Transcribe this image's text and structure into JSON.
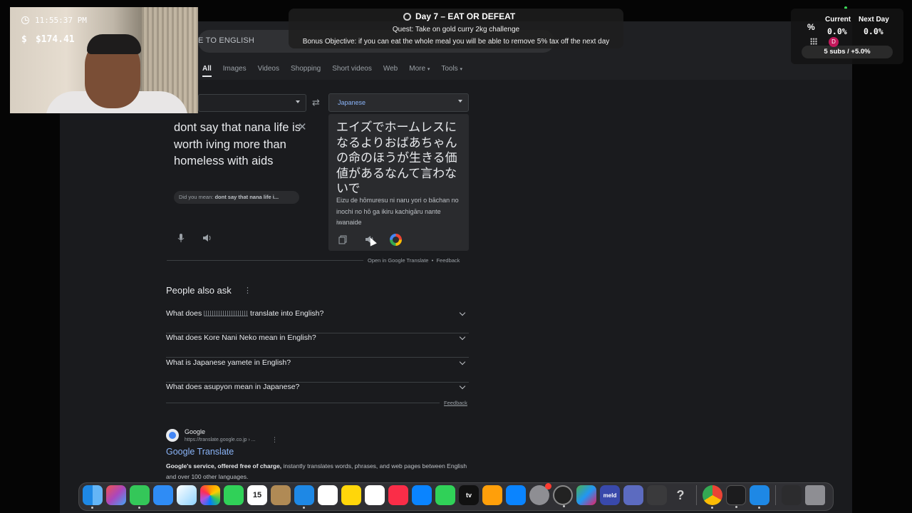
{
  "webcam": {
    "time": "11:55:37 PM",
    "currency_symbol": "$",
    "balance": "$174.41"
  },
  "quest": {
    "title": "Day 7 – EAT OR DEFEAT",
    "quest_line": "Quest: Take on gold curry 2kg challenge",
    "bonus_line": "Bonus Objective: if you can eat the whole meal you will be able to remove 5% tax off the next day"
  },
  "tax": {
    "percent_symbol": "%",
    "current_label": "Current",
    "next_label": "Next Day",
    "current_value": "0.0%",
    "next_value": "0.0%",
    "avatar_letter": "D",
    "subs": "5 subs / +5.0%"
  },
  "search": {
    "query_visible": "E TO ENGLISH"
  },
  "nav_tabs": [
    {
      "label": "All"
    },
    {
      "label": "Images"
    },
    {
      "label": "Videos"
    },
    {
      "label": "Shopping"
    },
    {
      "label": "Short videos"
    },
    {
      "label": "Web"
    },
    {
      "label": "More"
    },
    {
      "label": "Tools"
    }
  ],
  "translate": {
    "target_lang": "Japanese",
    "source_text": "dont say that nana life is worth iving more than homeless with aids",
    "did_you_mean_label": "Did you mean:",
    "did_you_mean_value": "dont say that nana life i...",
    "target_text": "エイズでホームレスになるよりおばあちゃんの命のほうが生きる価値があるなんて言わないで",
    "romanization": "Eizu de hōmuresu ni naru yori o bāchan no inochi no hō ga ikiru kachigāru nante iwanaide",
    "open_link": "Open in Google Translate",
    "separator": "•",
    "feedback": "Feedback",
    "close_glyph": "✕",
    "swap_glyph": "⇄"
  },
  "paa": {
    "title": "People also ask",
    "questions": [
      {
        "prefix": "What does",
        "suffix": "translate into English?"
      },
      {
        "text": "What does Kore Nani Neko mean in English?"
      },
      {
        "text": "What is Japanese yamete in English?"
      },
      {
        "text": "What does asupyon mean in Japanese?"
      }
    ],
    "feedback": "Feedback"
  },
  "result": {
    "site": "Google",
    "url": "https://translate.google.co.jp › ...",
    "title": "Google Translate",
    "snippet_bold": "Google's service, offered free of charge,",
    "snippet_rest": " instantly translates words, phrases, and web pages between English and over 100 other languages."
  },
  "dock": {
    "calendar_day": "15",
    "appletv": "tv",
    "meld": "meld",
    "help_glyph": "?"
  }
}
